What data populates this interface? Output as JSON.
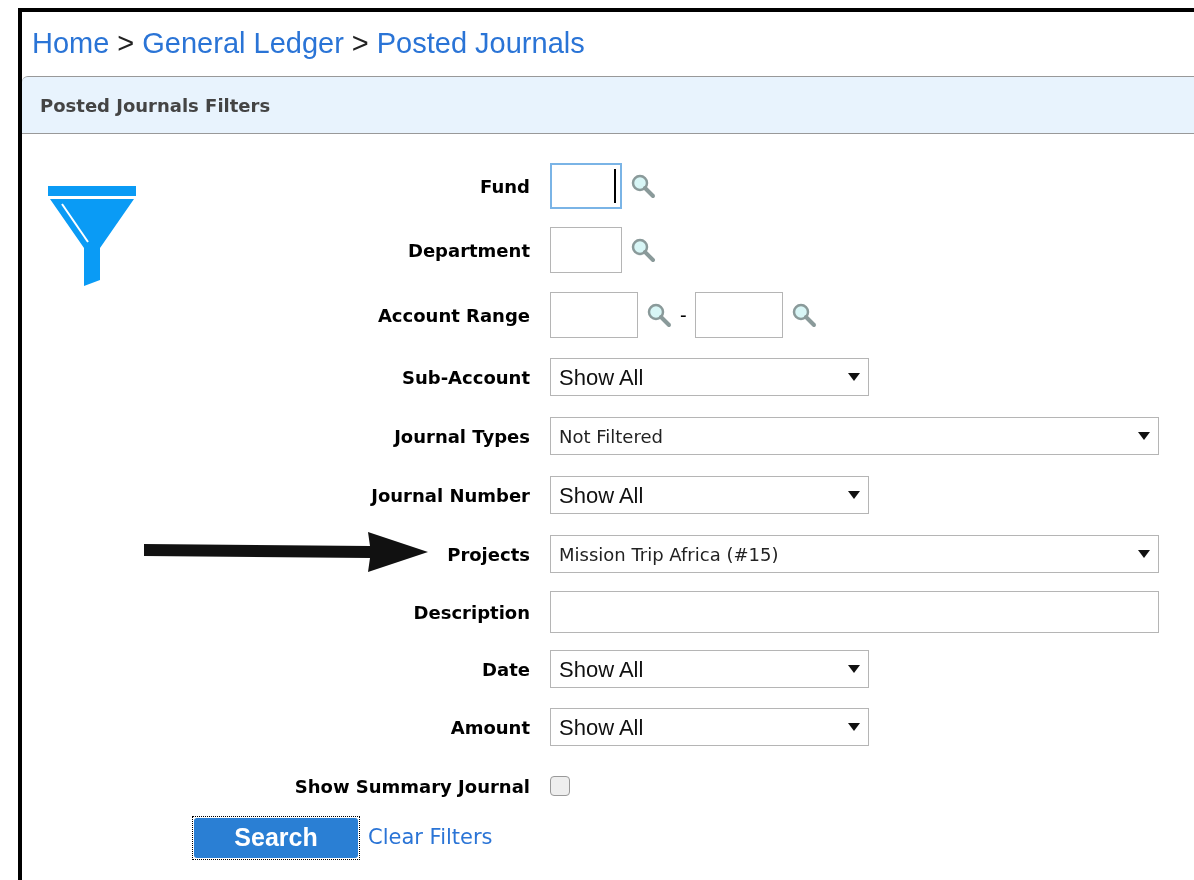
{
  "breadcrumb": [
    {
      "label": "Home"
    },
    {
      "label": "General Ledger"
    },
    {
      "label": "Posted Journals"
    }
  ],
  "breadcrumb_separator": ">",
  "panel": {
    "title": "Posted Journals Filters"
  },
  "fields": [
    {
      "kind": "lookup",
      "label": "Fund",
      "focused": true
    },
    {
      "kind": "lookup",
      "label": "Department",
      "focused": false
    },
    {
      "kind": "range",
      "label": "Account Range",
      "separator": "-"
    },
    {
      "kind": "select",
      "label": "Sub-Account",
      "value": "Show All"
    },
    {
      "kind": "combo",
      "label": "Journal Types",
      "value": "Not Filtered"
    },
    {
      "kind": "select",
      "label": "Journal Number",
      "value": "Show All"
    },
    {
      "kind": "combo",
      "label": "Projects",
      "value": "Mission Trip Africa (#15)",
      "pointer_arrow": true
    },
    {
      "kind": "text",
      "label": "Description"
    },
    {
      "kind": "select",
      "label": "Date",
      "value": "Show All"
    },
    {
      "kind": "select",
      "label": "Amount",
      "value": "Show All"
    },
    {
      "kind": "checkbox",
      "label": "Show Summary Journal",
      "checked": false
    }
  ],
  "actions": {
    "search": "Search",
    "clear": "Clear Filters"
  }
}
